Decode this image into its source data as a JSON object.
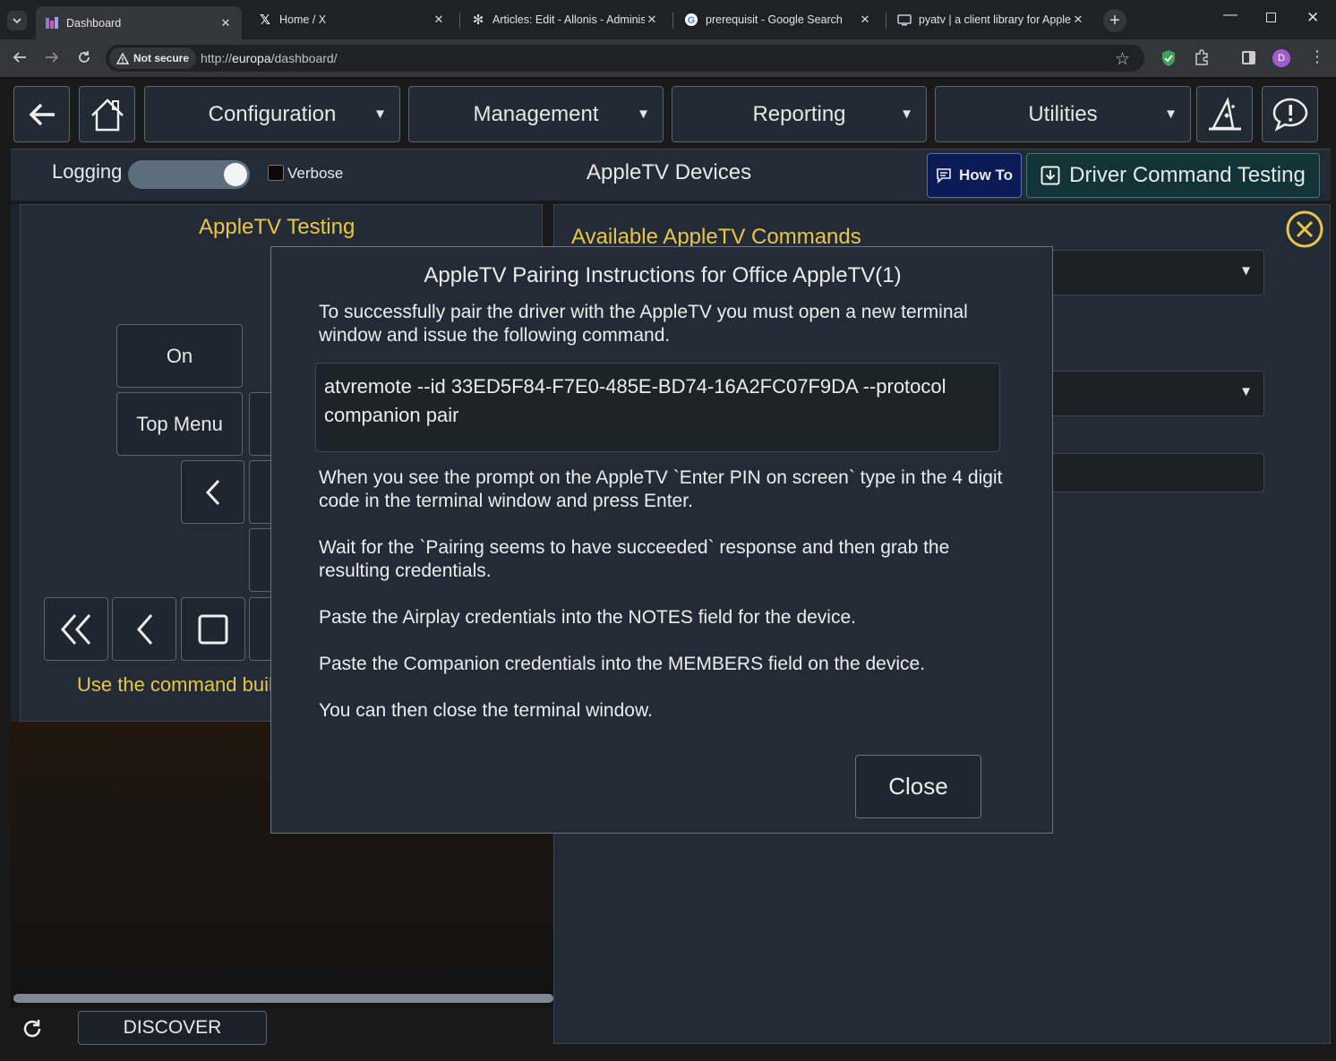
{
  "browser": {
    "tabs": [
      {
        "title": "Dashboard",
        "icon": "dashboard-favicon",
        "active": true
      },
      {
        "title": "Home / X",
        "icon": "x-favicon"
      },
      {
        "title": "Articles: Edit - Allonis - Adminis",
        "icon": "joomla-favicon"
      },
      {
        "title": "prerequisit - Google Search",
        "icon": "google-favicon"
      },
      {
        "title": "pyatv | a client library for Apple",
        "icon": "pyatv-favicon"
      }
    ],
    "security_label": "Not secure",
    "url_scheme": "http://",
    "url_host": "europa",
    "url_path": "/dashboard/",
    "profile_initial": "D"
  },
  "nav": {
    "menus": [
      "Configuration",
      "Management",
      "Reporting",
      "Utilities"
    ]
  },
  "logbar": {
    "logging_label": "Logging",
    "verbose_label": "Verbose",
    "title": "AppleTV Devices",
    "howto_label": "How To",
    "driver_testing_label": "Driver Command Testing"
  },
  "left_panel": {
    "title": "AppleTV Testing",
    "buttons": [
      "On",
      "Top Menu"
    ],
    "hint": "Use the command buil"
  },
  "right_panel": {
    "title": "Available AppleTV Commands"
  },
  "footer": {
    "discover_label": "DISCOVER"
  },
  "modal": {
    "title": "AppleTV Pairing Instructions for Office AppleTV(1)",
    "intro": "To successfully pair the driver with the AppleTV you must open a new terminal window and issue the following command.",
    "command": "atvremote --id 33ED5F84-F7E0-485E-BD74-16A2FC07F9DA --protocol companion pair",
    "step_pin": "When you see the prompt on the AppleTV `Enter PIN on screen` type in the 4 digit code in the terminal window and press Enter.",
    "step_wait": "Wait for the `Pairing seems to have succeeded` response and then grab the resulting credentials.",
    "step_airplay": "Paste the Airplay credentials into the NOTES field for the device.",
    "step_companion": "Paste the Companion credentials into the MEMBERS field on the device.",
    "step_close": "You can then close the terminal window.",
    "close_label": "Close"
  },
  "colors": {
    "accent_yellow": "#e8c547",
    "panel_bg": "#232c36",
    "howto_bg": "#0b1b55",
    "driver_testing_bg": "#123436"
  }
}
